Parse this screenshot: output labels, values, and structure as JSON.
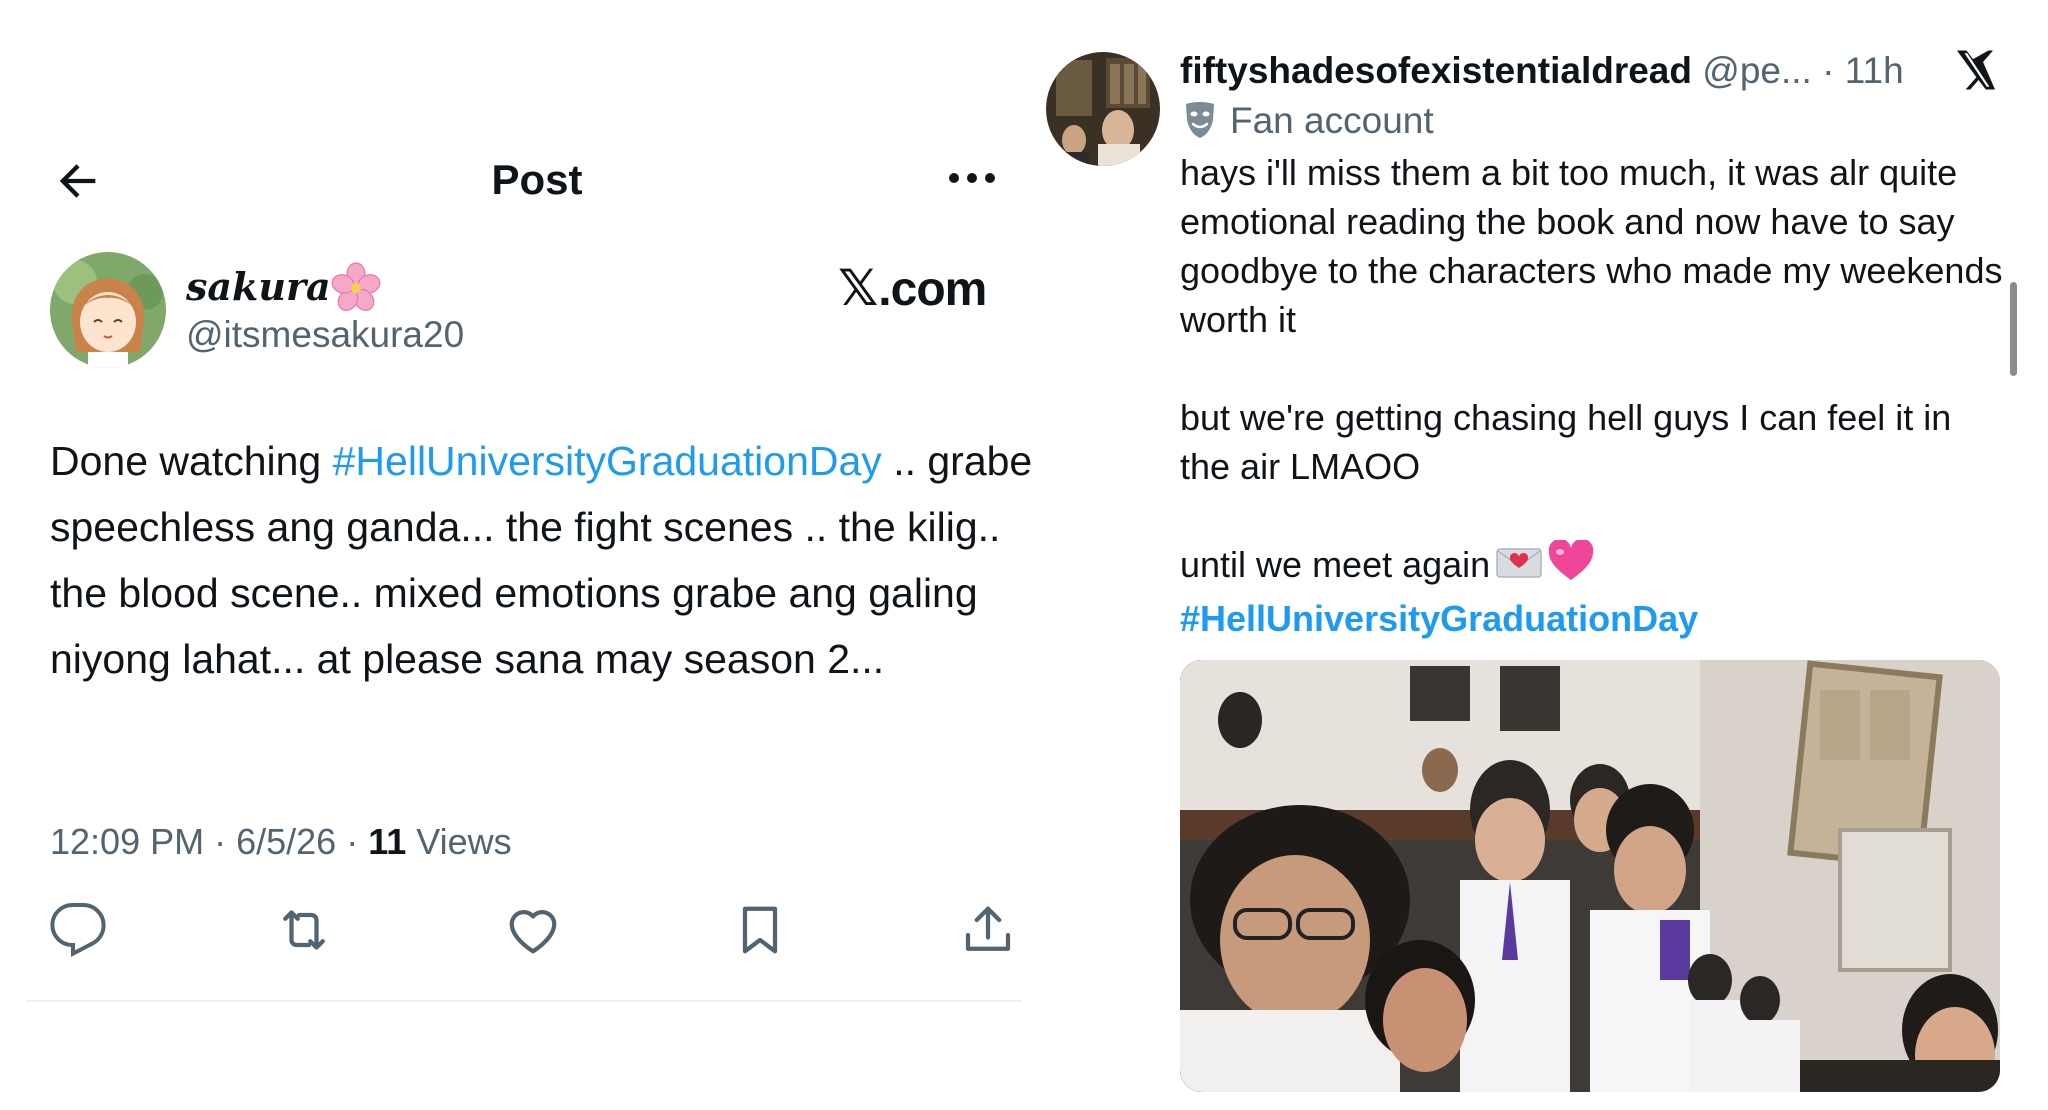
{
  "left_post": {
    "header": {
      "title": "Post"
    },
    "author": {
      "display_name": "sakura",
      "handle": "@itsmesakura20"
    },
    "badge": "𝕏.com",
    "badge_x": "𝕏",
    "badge_domain": ".com",
    "body": {
      "part1": "Done watching ",
      "hashtag": "#HellUniversityGraduationDay",
      "part2": " .. grabe speechless ang ganda... the fight scenes .. the kilig.. the blood scene.. mixed emotions grabe ang galing niyong lahat... at please sana may season 2..."
    },
    "meta": {
      "time": "12:09 PM",
      "sep": " · ",
      "date": "6/5/26",
      "sep2": " · ",
      "views_count": "11",
      "views_label": " Views"
    },
    "icons": [
      "back-arrow-icon",
      "more-icon",
      "blossom-icon",
      "reply-icon",
      "repost-icon",
      "like-icon",
      "bookmark-icon",
      "share-icon"
    ]
  },
  "right_post": {
    "author": {
      "display_name": "fiftyshadesofexistentialdread",
      "handle": "@pe...",
      "sep": " · ",
      "time": "11h",
      "label": "Fan account"
    },
    "body": {
      "para1": "hays i'll miss them a bit too much, it was alr quite emotional reading the book and now have to say goodbye to the characters who made my weekends worth it",
      "para2": "but we're getting chasing hell guys I can feel it in the air LMAOO",
      "para3": "until we meet again",
      "hashtag": "#HellUniversityGraduationDay"
    },
    "icons": [
      "x-logo-icon",
      "theater-masks-icon",
      "love-letter-icon",
      "pink-heart-icon"
    ]
  },
  "colors": {
    "link": "#1d9bf0",
    "secondary_text": "#536471",
    "primary_text": "#0f1419",
    "divider": "#eff3f4"
  }
}
